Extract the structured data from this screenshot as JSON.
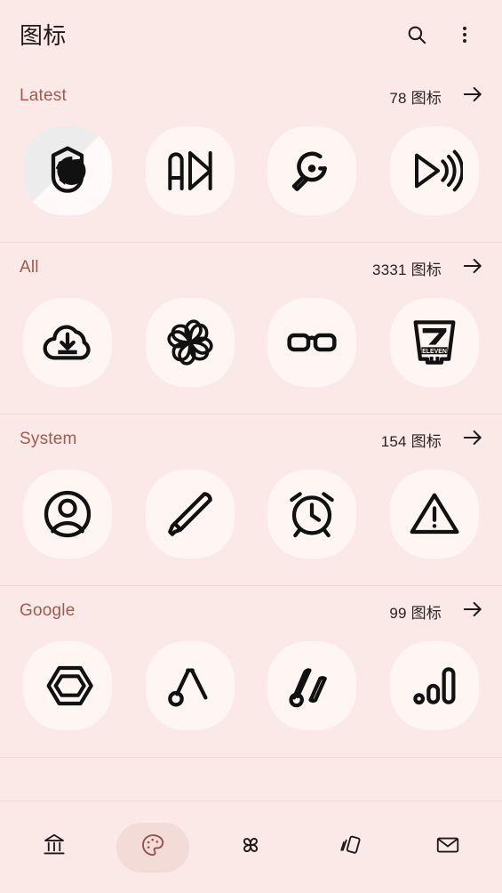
{
  "app": {
    "title": "图标",
    "background_color": "#fbe9e7",
    "tile_color": "#fff6f4",
    "accent_color": "#a05a53",
    "divider_color": "#f0d9d6"
  },
  "appbar": {
    "title": "图标",
    "actions": [
      {
        "name": "search-icon",
        "label": "搜索"
      },
      {
        "name": "more-vert-icon",
        "label": "更多选项"
      }
    ]
  },
  "sections": [
    {
      "id": "latest",
      "name": "Latest",
      "count_text": "78 图标",
      "count": 78,
      "arrow_label": "查看全部",
      "icons": [
        {
          "name": "globe-icon",
          "label": "地球",
          "shaded": true
        },
        {
          "name": "fast-forward-icon",
          "label": "快进"
        },
        {
          "name": "search-tool-icon",
          "label": "搜索工具"
        },
        {
          "name": "play-sound-icon",
          "label": "播放声音"
        }
      ]
    },
    {
      "id": "all",
      "name": "All",
      "count_text": "3331 图标",
      "count": 3331,
      "arrow_label": "查看全部",
      "icons": [
        {
          "name": "cloud-download-icon",
          "label": "云下载"
        },
        {
          "name": "flower-swirl-icon",
          "label": "花瓣漩涡"
        },
        {
          "name": "glasses-icon",
          "label": "眼镜"
        },
        {
          "name": "seven-eleven-icon",
          "label": "7-ELEVEN"
        }
      ]
    },
    {
      "id": "system",
      "name": "System",
      "count_text": "154 图标",
      "count": 154,
      "arrow_label": "查看全部",
      "icons": [
        {
          "name": "account-circle-icon",
          "label": "账户"
        },
        {
          "name": "pen-icon",
          "label": "钢笔"
        },
        {
          "name": "alarm-clock-icon",
          "label": "闹钟"
        },
        {
          "name": "warning-triangle-icon",
          "label": "警告"
        }
      ]
    },
    {
      "id": "google",
      "name": "Google",
      "count_text": "99 图标",
      "count": 99,
      "arrow_label": "查看全部",
      "icons": [
        {
          "name": "google-cloud-hexagon-icon",
          "label": "Google Cloud"
        },
        {
          "name": "google-ads-icon",
          "label": "Google Ads"
        },
        {
          "name": "google-analytics-bars-icon",
          "label": "Google Analytics"
        },
        {
          "name": "signal-bars-icon",
          "label": "信号条"
        }
      ]
    }
  ],
  "bottom_nav": {
    "active_index": 1,
    "items": [
      {
        "name": "museum-icon",
        "label": "博物馆"
      },
      {
        "name": "palette-icon",
        "label": "调色板"
      },
      {
        "name": "pinwheel-icon",
        "label": "风车"
      },
      {
        "name": "cards-swipe-icon",
        "label": "卡片"
      },
      {
        "name": "mail-icon",
        "label": "邮件"
      }
    ]
  }
}
